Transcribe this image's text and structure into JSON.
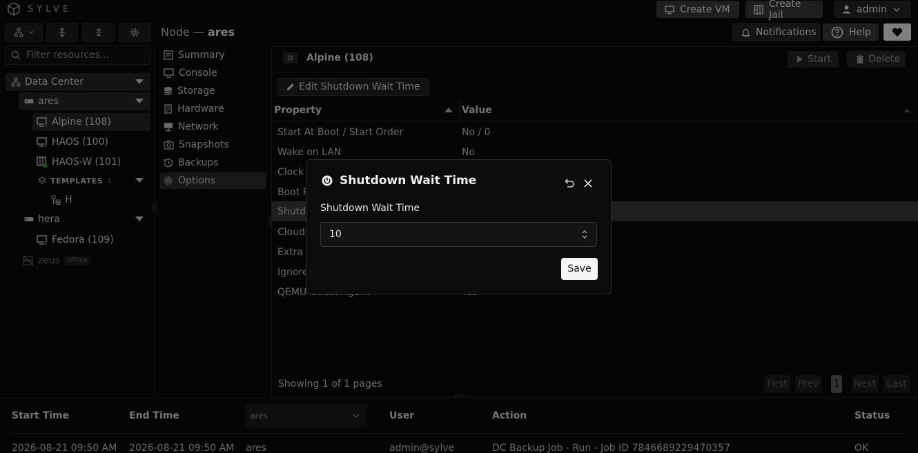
{
  "app": {
    "logo_text": "SYLVE"
  },
  "topbar": {
    "create_vm": "Create VM",
    "create_jail": "Create Jail",
    "user": "admin",
    "notifications": "Notifications",
    "help": "Help"
  },
  "filter": {
    "placeholder": "Filter resources..."
  },
  "tree": {
    "datacenter": "Data Center",
    "nodes": [
      {
        "name": "ares"
      },
      {
        "name": "hera"
      },
      {
        "name": "zeus",
        "badge": "Offline"
      }
    ],
    "ares_items": [
      "Alpine (108)",
      "HAOS (100)",
      "HAOS-W (101)"
    ],
    "templates_label": "TEMPLATES",
    "templates_count": "1",
    "template_item": "H",
    "hera_items": [
      "Fedora (109)"
    ]
  },
  "breadcrumb": {
    "prefix": "Node —",
    "node": "ares"
  },
  "menu": [
    "Summary",
    "Console",
    "Storage",
    "Hardware",
    "Network",
    "Snapshots",
    "Backups",
    "Options"
  ],
  "vm": {
    "title": "Alpine (108)",
    "start": "Start",
    "delete": "Delete",
    "edit_button": "Edit Shutdown Wait Time"
  },
  "table": {
    "headers": [
      "Property",
      "Value"
    ],
    "rows": [
      {
        "property": "Start At Boot / Start Order",
        "value": "No / 0"
      },
      {
        "property": "Wake on LAN",
        "value": "No"
      },
      {
        "property": "Clock Offset",
        "value": ""
      },
      {
        "property": "Boot ROM",
        "value": ""
      },
      {
        "property": "Shutdown Wait Time",
        "value": ""
      },
      {
        "property": "Cloud Init",
        "value": ""
      },
      {
        "property": "Extra BHyve Options",
        "value": ""
      },
      {
        "property": "Ignore MSRs",
        "value": ""
      },
      {
        "property": "QEMU Guest Agent",
        "value": "Yes"
      }
    ],
    "footer": "Showing 1 of 1 pages",
    "pager": {
      "first": "First",
      "prev": "Prev",
      "page": "1",
      "next": "Next",
      "last": "Last"
    }
  },
  "tasks": {
    "headers": [
      "Start Time",
      "End Time",
      "User",
      "Action",
      "Status"
    ],
    "host_filter": "ares",
    "rows": [
      {
        "start": "2026-08-21 09:50 AM",
        "end": "2026-08-21 09:50 AM",
        "node": "ares",
        "user": "admin@sylve",
        "action": "DC Backup Job - Run - Job ID 7846689229470357",
        "status": "OK"
      }
    ]
  },
  "dialog": {
    "title": "Shutdown Wait Time",
    "label": "Shutdown Wait Time",
    "value": "10",
    "save": "Save"
  },
  "colors": {
    "background": "#0a0a0a",
    "selected_row": "#3a3a3a",
    "button": "#3a3a3a",
    "online_dot": "#16a34a"
  }
}
